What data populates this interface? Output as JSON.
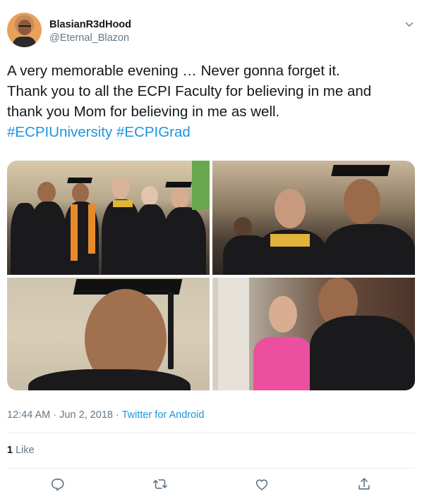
{
  "user": {
    "display_name": "BlasianR3dHood",
    "handle": "@Eternal_Blazon"
  },
  "tweet": {
    "lines": [
      "A very memorable evening … Never gonna forget it.",
      "Thank you to all the ECPI Faculty for believing in me and",
      "thank you Mom for believing in me as well."
    ],
    "hashtags": [
      "#ECPIUniversity",
      "#ECPIGrad"
    ]
  },
  "meta": {
    "time": "12:44 AM",
    "separator1": " · ",
    "date": "Jun 2, 2018",
    "separator2": " · ",
    "source": "Twitter for Android"
  },
  "stats": {
    "likes_count": "1",
    "likes_label": " Like"
  },
  "actions": {
    "reply_icon": "reply-icon",
    "retweet_icon": "retweet-icon",
    "like_icon": "heart-icon",
    "share_icon": "share-icon"
  },
  "colors": {
    "link": "#1b95e0",
    "secondary_text": "#657786",
    "divider": "#e6ecf0"
  }
}
